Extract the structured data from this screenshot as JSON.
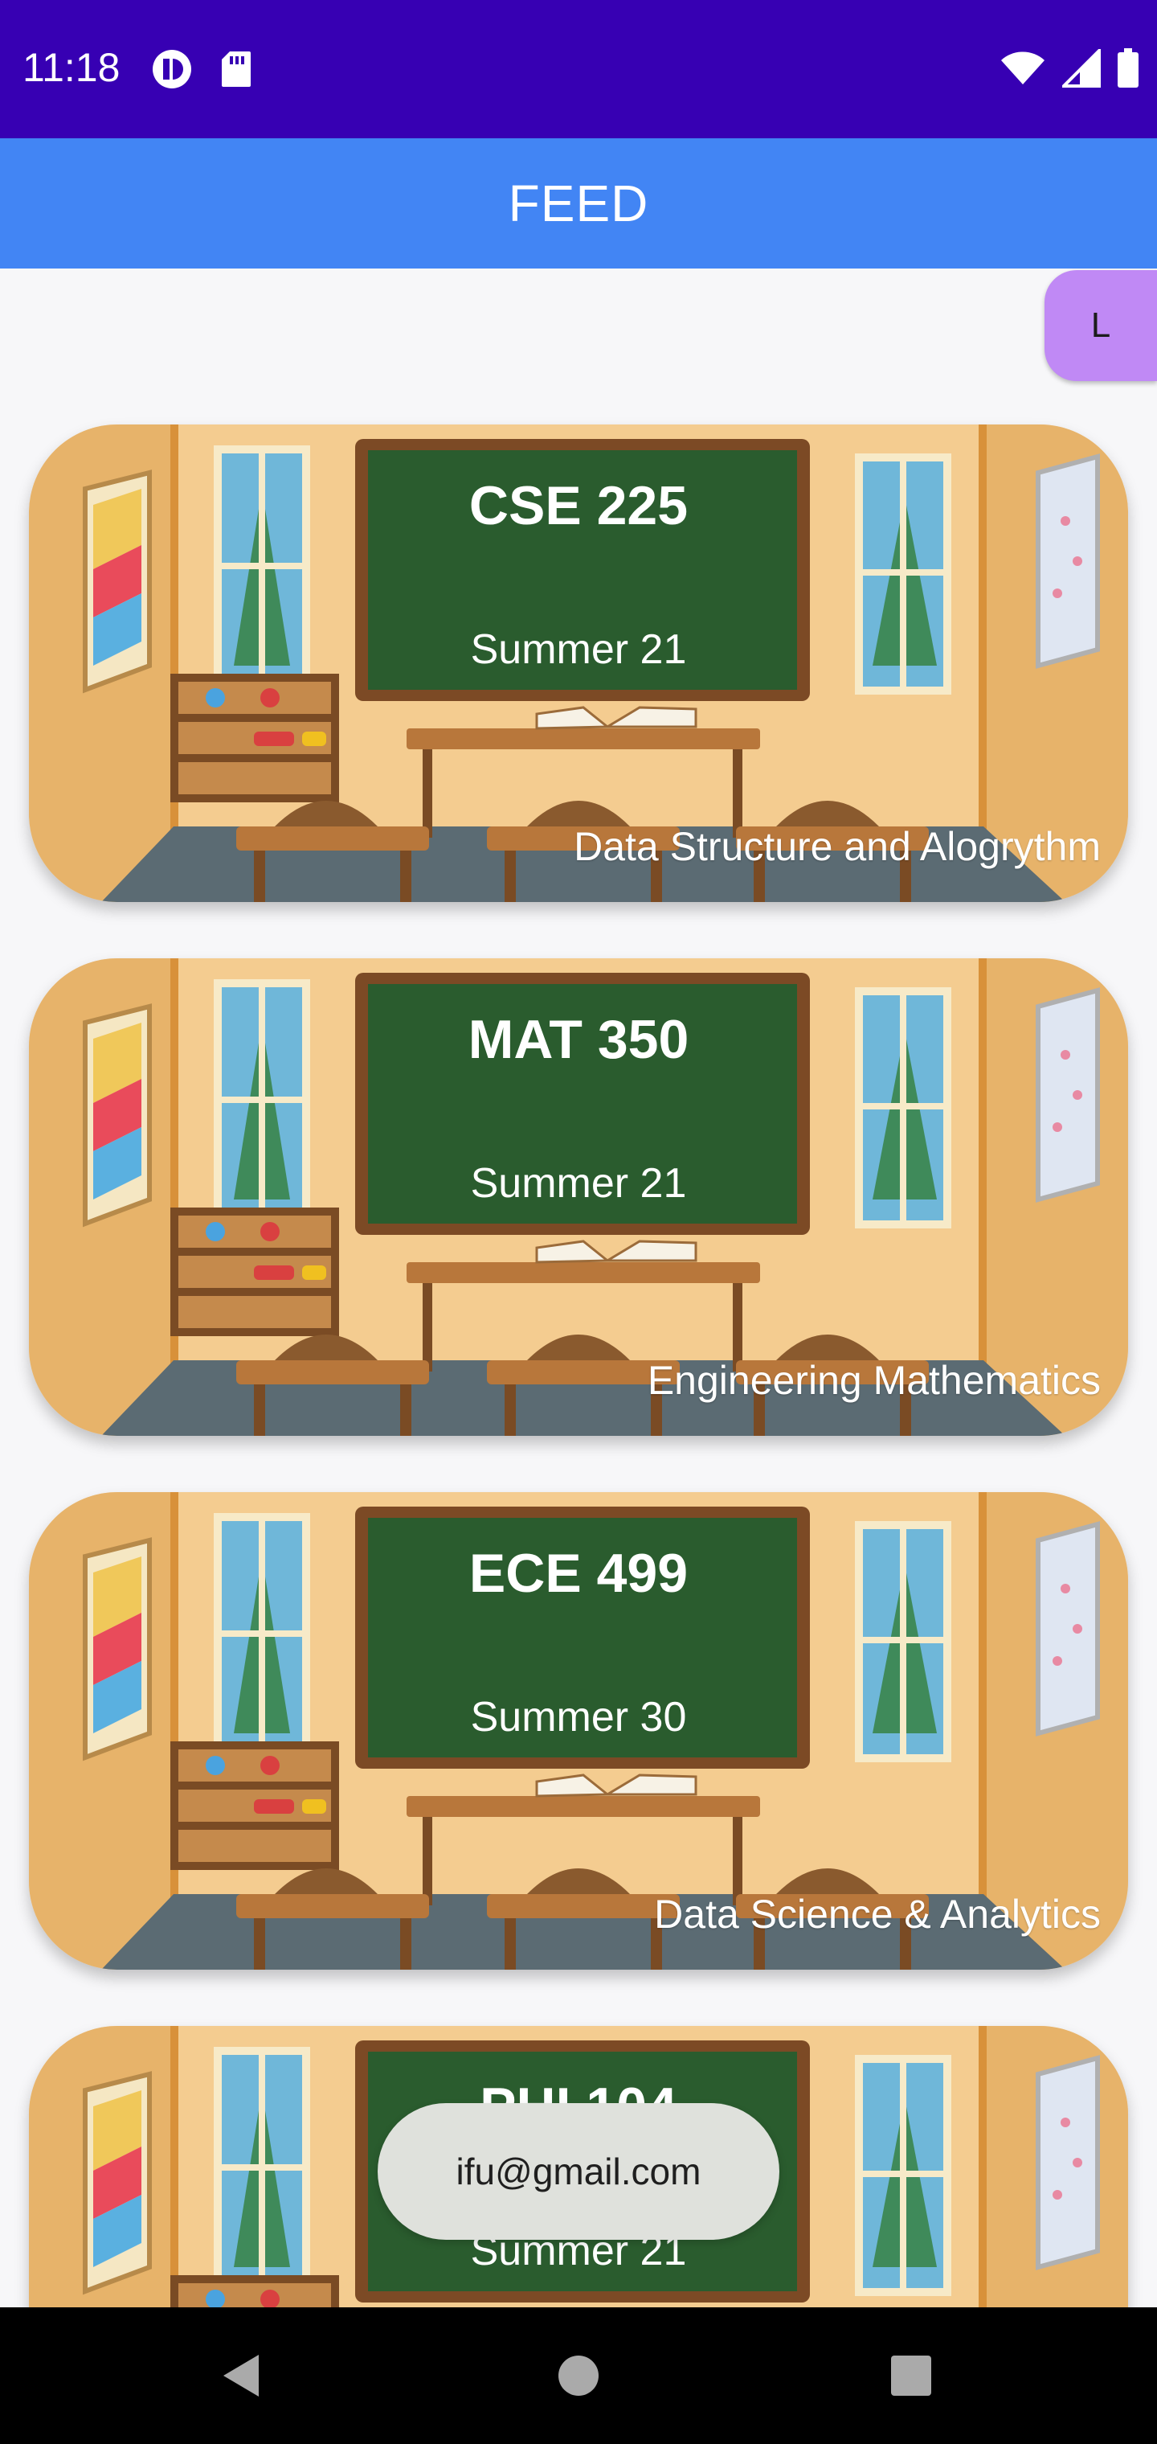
{
  "status_bar": {
    "time": "11:18",
    "icons_left": [
      "notification-icon",
      "sd-card-icon"
    ],
    "icons_right": [
      "wifi-icon",
      "signal-icon",
      "battery-icon"
    ]
  },
  "app_bar": {
    "title": "FEED"
  },
  "avatar": {
    "initial": "L"
  },
  "courses": [
    {
      "code": "CSE 225",
      "term": "Summer 21",
      "name": "Data Structure and Alogrythm"
    },
    {
      "code": "MAT 350",
      "term": "Summer 21",
      "name": "Engineering Mathematics"
    },
    {
      "code": "ECE 499",
      "term": "Summer 30",
      "name": "Data Science & Analytics"
    },
    {
      "code": "PHI 104",
      "term": "Summer 21",
      "name": ""
    }
  ],
  "toast": {
    "text": "ifu@gmail.com"
  },
  "nav_bar": {
    "buttons": [
      "back-icon",
      "home-icon",
      "recents-icon"
    ]
  },
  "colors": {
    "status_bar": "#3700b3",
    "app_bar": "#4285f4",
    "avatar": "#c089f5",
    "chalkboard": "#2a5c2e",
    "wall": "#f4cc90",
    "floor": "#5b6b73"
  }
}
